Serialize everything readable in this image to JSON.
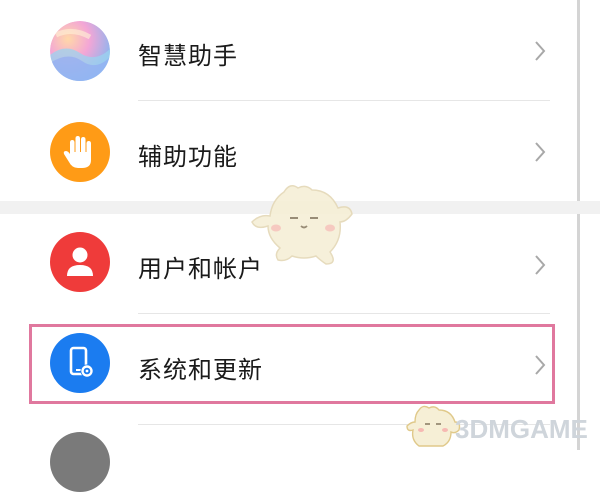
{
  "settings": {
    "items": [
      {
        "label": "智慧助手",
        "icon": "assistant-gradient-icon"
      },
      {
        "label": "辅助功能",
        "icon": "hand-icon"
      },
      {
        "label": "用户和帐户",
        "icon": "user-icon"
      },
      {
        "label": "系统和更新",
        "icon": "phone-gear-icon"
      },
      {
        "label": "",
        "icon": "gray-circle-icon"
      }
    ]
  },
  "watermark": {
    "text": "3DMGAME"
  },
  "colors": {
    "accessibility_icon": "#ff9b16",
    "user_icon": "#ef3b3a",
    "system_icon": "#1b7cf0",
    "highlight_border": "#e0789e",
    "label_text": "#1a1a1a",
    "chevron": "#a8a8a8"
  }
}
